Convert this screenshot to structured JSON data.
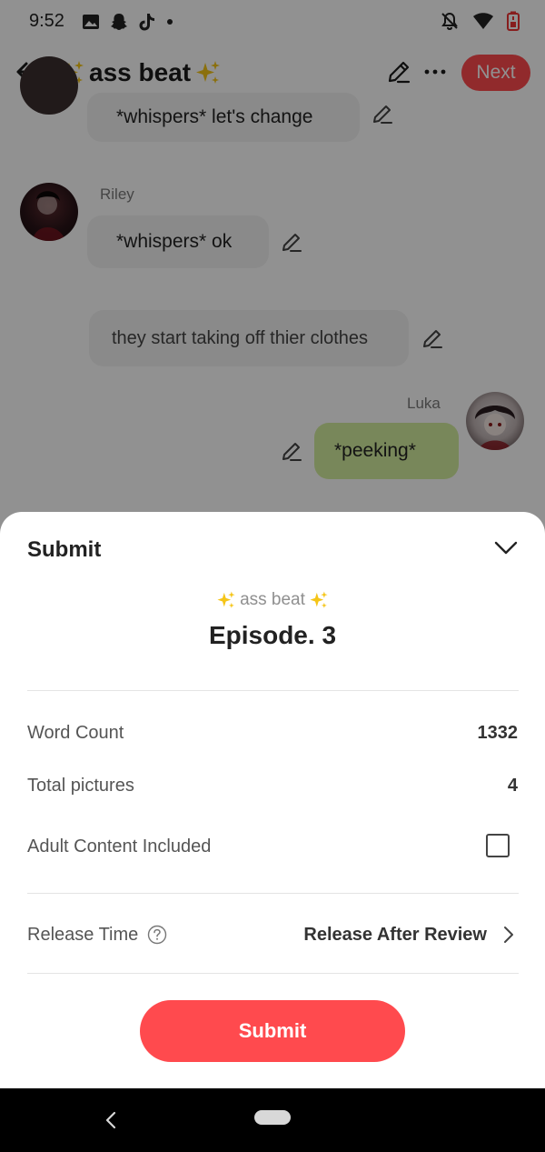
{
  "status_bar": {
    "time": "9:52",
    "left_icons": [
      "image-icon",
      "snapchat-icon",
      "tiktok-icon",
      "dot-icon"
    ],
    "right_icons": [
      "bell-off-icon",
      "wifi-icon",
      "battery-low-icon"
    ]
  },
  "header": {
    "title": "ass beat",
    "title_decoration": "sparkles-icon",
    "next_label": "Next"
  },
  "chat": {
    "messages": [
      {
        "sender": "",
        "text": "*whispers* let's change",
        "type": "left"
      },
      {
        "sender": "Riley",
        "text": "*whispers* ok",
        "type": "left"
      },
      {
        "sender": "",
        "text": "they start taking off thier clothes",
        "type": "narration"
      },
      {
        "sender": "Luka",
        "text": "*peeking*",
        "type": "right"
      }
    ]
  },
  "sheet": {
    "title": "Submit",
    "story_name": "ass beat",
    "episode": "Episode. 3",
    "rows": {
      "word_count_label": "Word Count",
      "word_count_value": "1332",
      "pictures_label": "Total pictures",
      "pictures_value": "4",
      "adult_label": "Adult Content Included",
      "adult_checked": false,
      "release_label": "Release Time",
      "release_value": "Release After Review"
    },
    "submit_label": "Submit"
  },
  "colors": {
    "accent": "#ff4a4e",
    "right_bubble": "#d4ee9e",
    "sparkle": "#f5c518"
  }
}
